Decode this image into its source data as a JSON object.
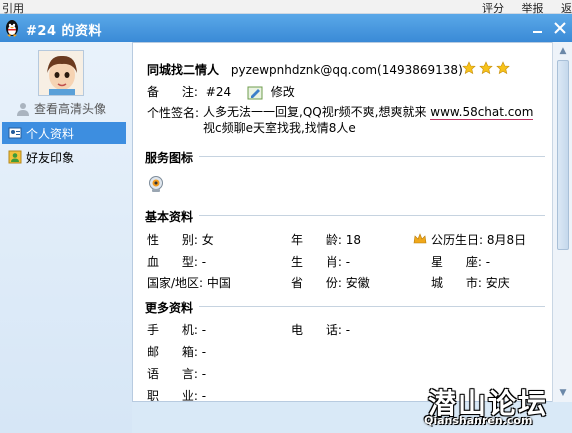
{
  "background_app": {
    "left_menu": "引用",
    "right_menu": [
      "评分",
      "举报",
      "返"
    ]
  },
  "window": {
    "title": "#24  的资料",
    "title_icon": "qq-penguin-icon",
    "buttons": [
      "minimize",
      "close"
    ]
  },
  "sidebar": {
    "hd_avatar_link": "查看高清头像",
    "items": [
      {
        "label": "个人资料",
        "icon": "person-card-icon",
        "active": true
      },
      {
        "label": "好友印象",
        "icon": "friend-impression-icon",
        "active": false
      }
    ]
  },
  "profile": {
    "nickname": "同城找二情人",
    "email": "pyzewpnhdznk@qq.com(1493869138)",
    "remark_label": "备      注:",
    "remark_value": "#24",
    "edit_label": "修改",
    "signature_label": "个性签名:",
    "signature_text_1": "人多无法一一回复,QQ视r频不爽,想爽就来 ",
    "signature_url": "www.58chat.com",
    "signature_text_2": " 视c频聊e天室找我,找情8人e",
    "level_stars": 3
  },
  "sections": {
    "service": "服务图标",
    "basic": "基本资料",
    "more": "更多资料"
  },
  "basic_info": {
    "gender_label": "性      别:",
    "gender": "女",
    "age_label": "年      龄:",
    "age": "18",
    "birthday_label": "公历生日:",
    "birthday": "8月8日",
    "blood_label": "血      型:",
    "blood": "-",
    "zodiac_label": "生      肖:",
    "zodiac": "-",
    "star_label": "星      座:",
    "star": "-",
    "country_label": "国家/地区:",
    "country": "中国",
    "province_label": "省      份:",
    "province": "安徽",
    "city_label": "城      市:",
    "city": "安庆"
  },
  "more_info": {
    "mobile_label": "手      机:",
    "mobile": "-",
    "phone_label": "电      话:",
    "phone": "-",
    "email_label": "邮      箱:",
    "email": "-",
    "language_label": "语      言:",
    "language": "-",
    "job_label": "职      业:",
    "job": "-"
  },
  "watermark": {
    "cn": "潜山论坛",
    "en": "Qianshanren.com"
  },
  "colors": {
    "titlebar": "#3a8ad6",
    "sidebar_active": "#3d8ee0",
    "url_underline": "#c03060"
  }
}
